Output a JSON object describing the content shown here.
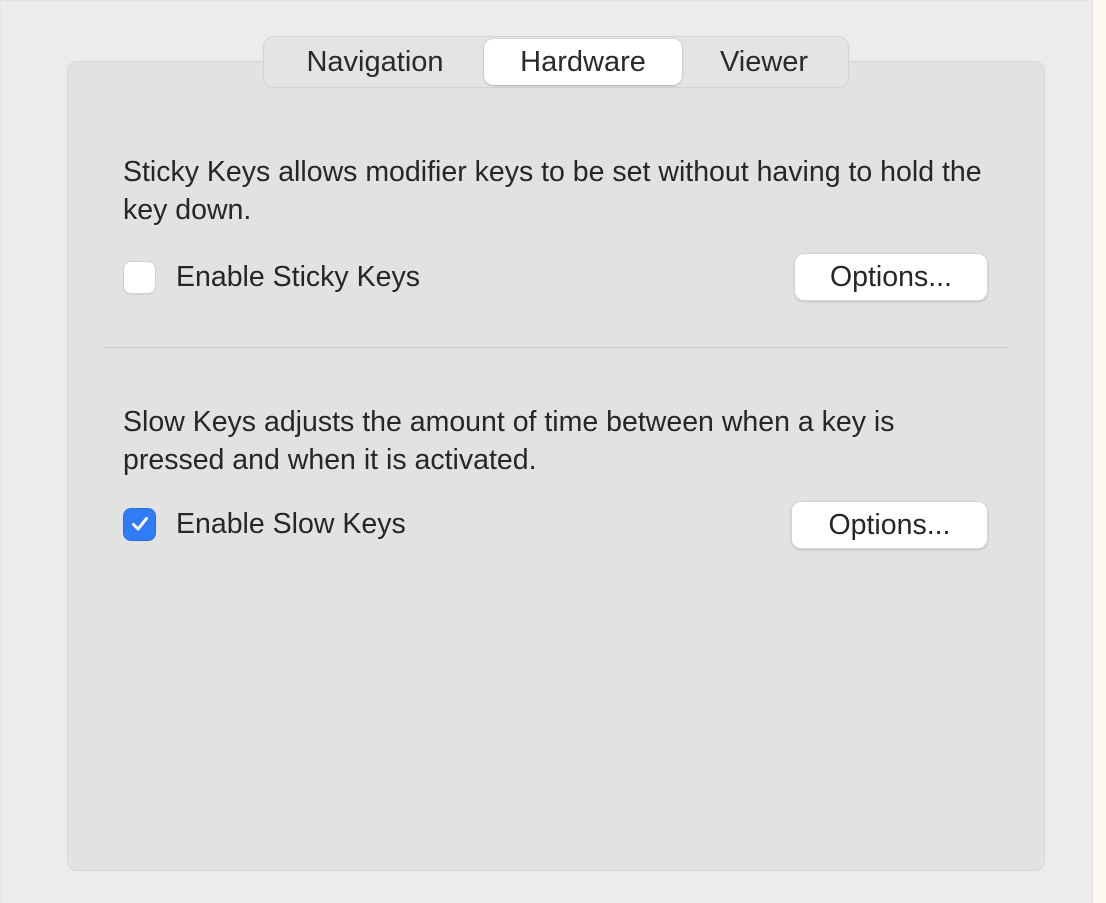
{
  "tabs": [
    {
      "label": "Navigation",
      "selected": false
    },
    {
      "label": "Hardware",
      "selected": true
    },
    {
      "label": "Viewer",
      "selected": false
    }
  ],
  "sticky_keys": {
    "description": "Sticky Keys allows modifier keys to be set without having to hold the key down.",
    "checkbox_label": "Enable Sticky Keys",
    "checked": false,
    "options_label": "Options..."
  },
  "slow_keys": {
    "description": "Slow Keys adjusts the amount of time between when a key is pressed and when it is activated.",
    "checkbox_label": "Enable Slow Keys",
    "checked": true,
    "options_label": "Options..."
  },
  "colors": {
    "accent": "#2f7cf6",
    "panel_bg": "#e2e2e2",
    "window_bg": "#ececec"
  },
  "icons": {
    "checkmark": "checkmark-icon"
  }
}
